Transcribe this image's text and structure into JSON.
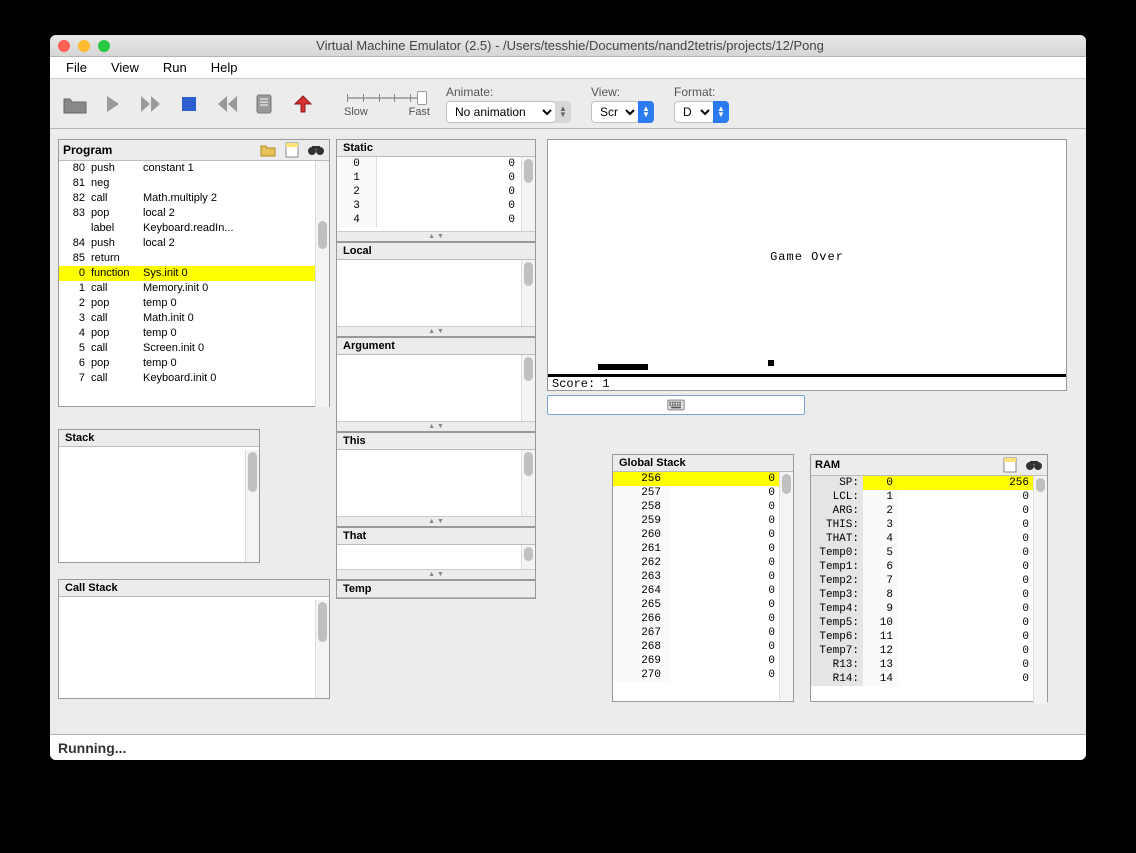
{
  "window": {
    "title": "Virtual Machine Emulator (2.5) - /Users/tesshie/Documents/nand2tetris/projects/12/Pong"
  },
  "menu": {
    "items": [
      "File",
      "View",
      "Run",
      "Help"
    ]
  },
  "toolbar": {
    "animate_label": "Animate:",
    "view_label": "View:",
    "format_label": "Format:",
    "slow": "Slow",
    "fast": "Fast",
    "animate_value": "No animation",
    "view_value": "Scr...",
    "format_value": "D..."
  },
  "program": {
    "title": "Program",
    "rows": [
      {
        "n": "80",
        "op": "push",
        "arg": "constant 1"
      },
      {
        "n": "81",
        "op": "neg",
        "arg": ""
      },
      {
        "n": "82",
        "op": "call",
        "arg": "Math.multiply 2"
      },
      {
        "n": "83",
        "op": "pop",
        "arg": "local 2"
      },
      {
        "n": "",
        "op": "label",
        "arg": "Keyboard.readIn..."
      },
      {
        "n": "84",
        "op": "push",
        "arg": "local 2"
      },
      {
        "n": "85",
        "op": "return",
        "arg": ""
      },
      {
        "n": "0",
        "op": "function",
        "arg": "Sys.init 0",
        "hl": true
      },
      {
        "n": "1",
        "op": "call",
        "arg": "Memory.init 0"
      },
      {
        "n": "2",
        "op": "pop",
        "arg": "temp 0"
      },
      {
        "n": "3",
        "op": "call",
        "arg": "Math.init 0"
      },
      {
        "n": "4",
        "op": "pop",
        "arg": "temp 0"
      },
      {
        "n": "5",
        "op": "call",
        "arg": "Screen.init 0"
      },
      {
        "n": "6",
        "op": "pop",
        "arg": "temp 0"
      },
      {
        "n": "7",
        "op": "call",
        "arg": "Keyboard.init 0"
      }
    ]
  },
  "stack": {
    "title": "Stack"
  },
  "callstack": {
    "title": "Call Stack"
  },
  "segments": {
    "static": {
      "title": "Static",
      "rows": [
        [
          0,
          0
        ],
        [
          1,
          0
        ],
        [
          2,
          0
        ],
        [
          3,
          0
        ],
        [
          4,
          0
        ]
      ]
    },
    "local": {
      "title": "Local"
    },
    "argument": {
      "title": "Argument"
    },
    "this": {
      "title": "This"
    },
    "that": {
      "title": "That"
    },
    "temp": {
      "title": "Temp"
    }
  },
  "screen": {
    "game_over": "Game Over",
    "score": "Score: 1"
  },
  "global_stack": {
    "title": "Global Stack",
    "rows": [
      {
        "a": 256,
        "v": 0,
        "hl": true
      },
      {
        "a": 257,
        "v": 0
      },
      {
        "a": 258,
        "v": 0
      },
      {
        "a": 259,
        "v": 0
      },
      {
        "a": 260,
        "v": 0
      },
      {
        "a": 261,
        "v": 0
      },
      {
        "a": 262,
        "v": 0
      },
      {
        "a": 263,
        "v": 0
      },
      {
        "a": 264,
        "v": 0
      },
      {
        "a": 265,
        "v": 0
      },
      {
        "a": 266,
        "v": 0
      },
      {
        "a": 267,
        "v": 0
      },
      {
        "a": 268,
        "v": 0
      },
      {
        "a": 269,
        "v": 0
      },
      {
        "a": 270,
        "v": 0
      }
    ]
  },
  "ram": {
    "title": "RAM",
    "rows": [
      {
        "label": "SP:",
        "a": 0,
        "v": 256,
        "hl": true
      },
      {
        "label": "LCL:",
        "a": 1,
        "v": 0
      },
      {
        "label": "ARG:",
        "a": 2,
        "v": 0
      },
      {
        "label": "THIS:",
        "a": 3,
        "v": 0
      },
      {
        "label": "THAT:",
        "a": 4,
        "v": 0
      },
      {
        "label": "Temp0:",
        "a": 5,
        "v": 0
      },
      {
        "label": "Temp1:",
        "a": 6,
        "v": 0
      },
      {
        "label": "Temp2:",
        "a": 7,
        "v": 0
      },
      {
        "label": "Temp3:",
        "a": 8,
        "v": 0
      },
      {
        "label": "Temp4:",
        "a": 9,
        "v": 0
      },
      {
        "label": "Temp5:",
        "a": 10,
        "v": 0
      },
      {
        "label": "Temp6:",
        "a": 11,
        "v": 0
      },
      {
        "label": "Temp7:",
        "a": 12,
        "v": 0
      },
      {
        "label": "R13:",
        "a": 13,
        "v": 0
      },
      {
        "label": "R14:",
        "a": 14,
        "v": 0
      }
    ]
  },
  "status": {
    "text": "Running..."
  }
}
